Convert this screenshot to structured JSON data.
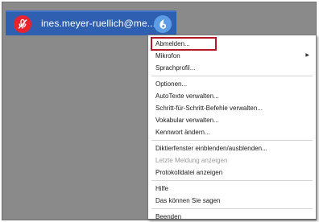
{
  "dictation_bar": {
    "user": "ines.meyer-ruellich@me...",
    "mic_icon": "microphone-off-icon",
    "dragon_icon": "dragon-flame-icon",
    "colors": {
      "bar": "#2e5fb0",
      "mic": "#e8232e",
      "dragon": "#5c9de4",
      "highlight": "#b11a24"
    }
  },
  "menu": {
    "items": [
      {
        "label": "Abmelden..."
      },
      {
        "label": "Mikrofon",
        "submenu_icon": "chevron-right-icon"
      },
      {
        "label": "Sprachprofil..."
      },
      {
        "label": "Optionen..."
      },
      {
        "label": "AutoTexte verwalten..."
      },
      {
        "label": "Schritt-für-Schritt-Befehle verwalten..."
      },
      {
        "label": "Vokabular verwalten..."
      },
      {
        "label": "Kennwort ändern..."
      },
      {
        "label": "Diktierfenster einblenden/ausblenden..."
      },
      {
        "label": "Letzte Meldung anzeigen",
        "disabled": true
      },
      {
        "label": "Protokolldatei anzeigen"
      },
      {
        "label": "Hilfe"
      },
      {
        "label": "Das können Sie sagen"
      },
      {
        "label": "Beenden"
      }
    ],
    "highlighted": "Abmelden..."
  }
}
